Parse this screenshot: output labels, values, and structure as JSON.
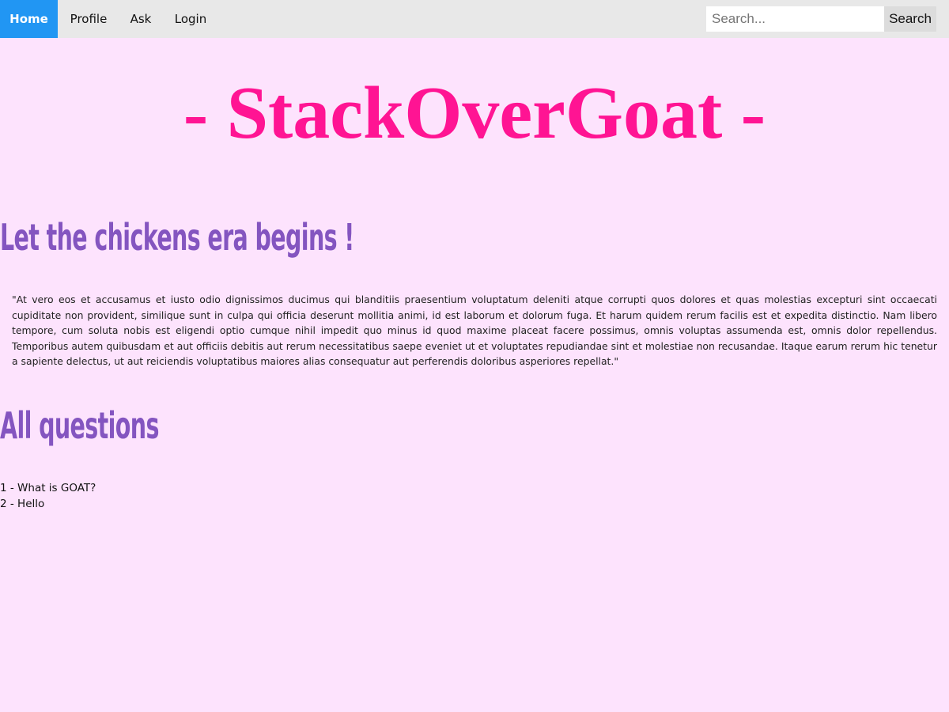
{
  "nav": {
    "links": [
      {
        "label": "Home"
      },
      {
        "label": "Profile"
      },
      {
        "label": "Ask"
      },
      {
        "label": "Login"
      }
    ],
    "search": {
      "placeholder": "Search...",
      "value": "",
      "button_label": "Search"
    }
  },
  "header": {
    "title": "- StackOverGoat -"
  },
  "hero": {
    "heading": "Let the chickens era begins !",
    "quote": "\"At vero eos et accusamus et iusto odio dignissimos ducimus qui blanditiis praesentium voluptatum deleniti atque corrupti quos dolores et quas molestias excepturi sint occaecati cupiditate non provident, similique sunt in culpa qui officia deserunt mollitia animi, id est laborum et dolorum fuga. Et harum quidem rerum facilis est et expedita distinctio. Nam libero tempore, cum soluta nobis est eligendi optio cumque nihil impedit quo minus id quod maxime placeat facere possimus, omnis voluptas assumenda est, omnis dolor repellendus. Temporibus autem quibusdam et aut officiis debitis aut rerum necessitatibus saepe eveniet ut et voluptates repudiandae sint et molestiae non recusandae. Itaque earum rerum hic tenetur a sapiente delectus, ut aut reiciendis voluptatibus maiores alias consequatur aut perferendis doloribus asperiores repellat.\""
  },
  "questions": {
    "heading": "All questions",
    "items": [
      {
        "label": "1 - What is GOAT?"
      },
      {
        "label": "2 - Hello"
      }
    ]
  },
  "colors": {
    "page_background": "#fde3fd",
    "nav_background": "#e8e8e8",
    "nav_active": "#2196f3",
    "title": "#ff1493",
    "heading": "#8455c0"
  }
}
